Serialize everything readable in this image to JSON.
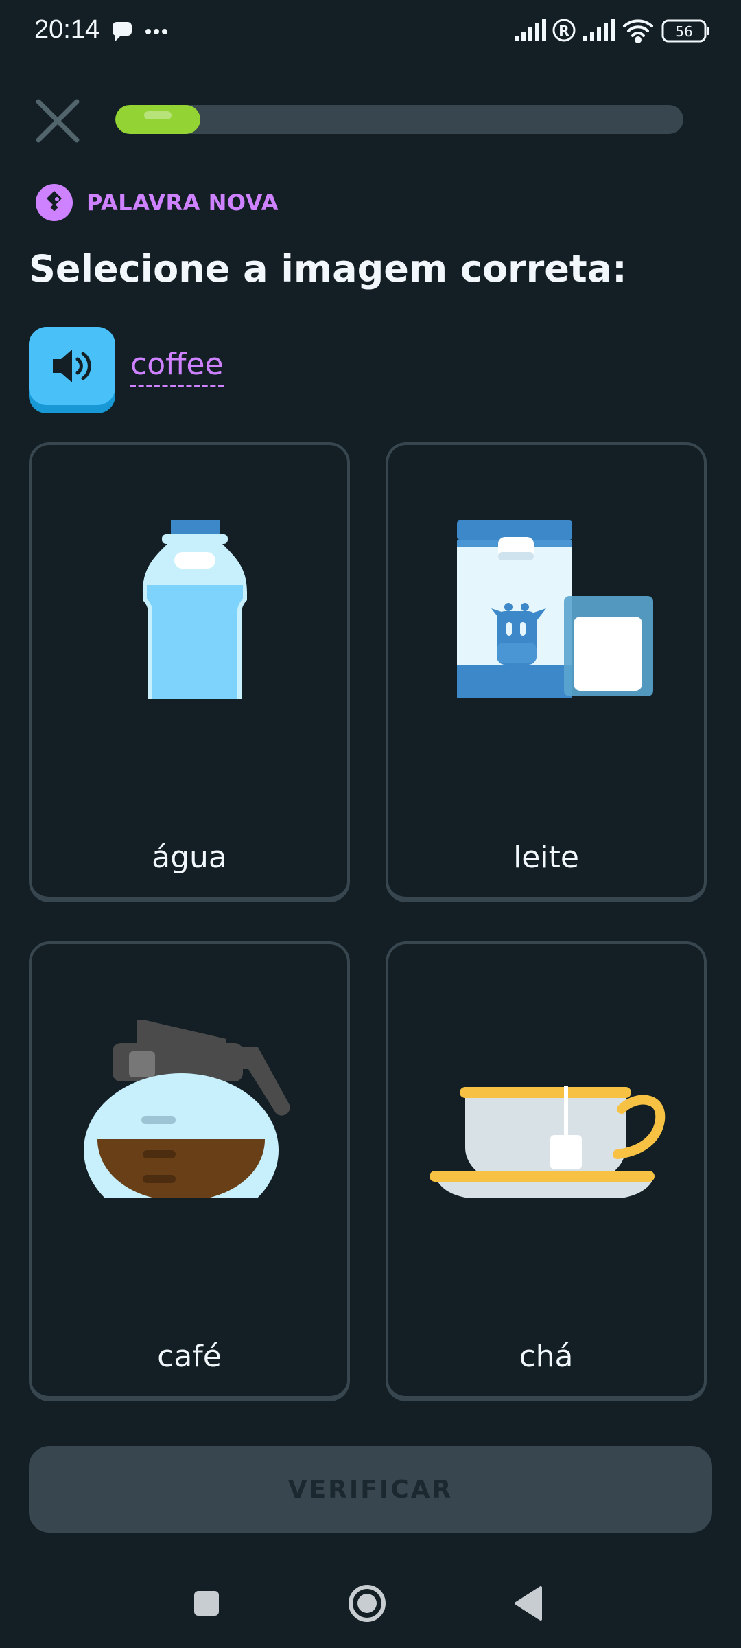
{
  "status_bar": {
    "time": "20:14",
    "battery": "56",
    "icons": [
      "chat-bubble-icon",
      "more-dots-icon",
      "signal-icon",
      "roaming-icon",
      "signal-icon",
      "wifi-icon",
      "battery-icon"
    ]
  },
  "progress": {
    "fraction": 0.15,
    "color": "#93d333",
    "track_color": "#37464f"
  },
  "header": {
    "badge_label": "PALAVRA NOVA",
    "badge_color": "#ce82ff",
    "title": "Selecione a imagem correta:"
  },
  "prompt": {
    "word": "coffee",
    "speaker_icon": "speaker-icon"
  },
  "choices": [
    {
      "label": "água",
      "icon": "water-bottle-icon"
    },
    {
      "label": "leite",
      "icon": "milk-carton-icon"
    },
    {
      "label": "café",
      "icon": "coffee-pot-icon"
    },
    {
      "label": "chá",
      "icon": "tea-cup-icon"
    }
  ],
  "footer": {
    "verify_label": "VERIFICAR"
  },
  "nav_bar": {
    "icons": [
      "recents-square-icon",
      "home-circle-icon",
      "back-triangle-icon"
    ]
  }
}
